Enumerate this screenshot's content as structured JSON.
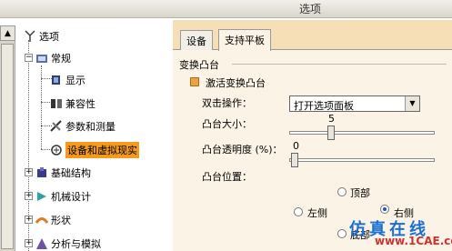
{
  "window": {
    "title": "选项"
  },
  "tree": {
    "root": "选项",
    "general": "常规",
    "display": "显示",
    "compat": "兼容性",
    "params": "参数和测量",
    "devices": "设备和虚拟现实",
    "infrastructure": "基础结构",
    "mech": "机械设计",
    "shape": "形状",
    "analysis": "分析与模拟"
  },
  "tabs": {
    "devices": "设备",
    "support": "支持平板"
  },
  "group": {
    "title": "变换凸台"
  },
  "form": {
    "activate_label": "激活变换凸台",
    "activate_checked": true,
    "dblclick_label": "双击操作：",
    "dblclick_value": "打开选项面板",
    "size_label": "凸台大小：",
    "size_value": "5",
    "opacity_label": "凸台透明度 (%)：",
    "opacity_value": "0",
    "position_label": "凸台位置：",
    "pos_top": "顶部",
    "pos_left": "左侧",
    "pos_right": "右侧",
    "pos_bottom": "底部",
    "pos_selected": "右侧"
  },
  "watermark": {
    "line1": "仿真在线",
    "line2": "www.1CAE.com"
  },
  "colors": {
    "panel_bg": "#f6dfb6",
    "selection": "#f59a1c",
    "accent": "#2050c8"
  }
}
